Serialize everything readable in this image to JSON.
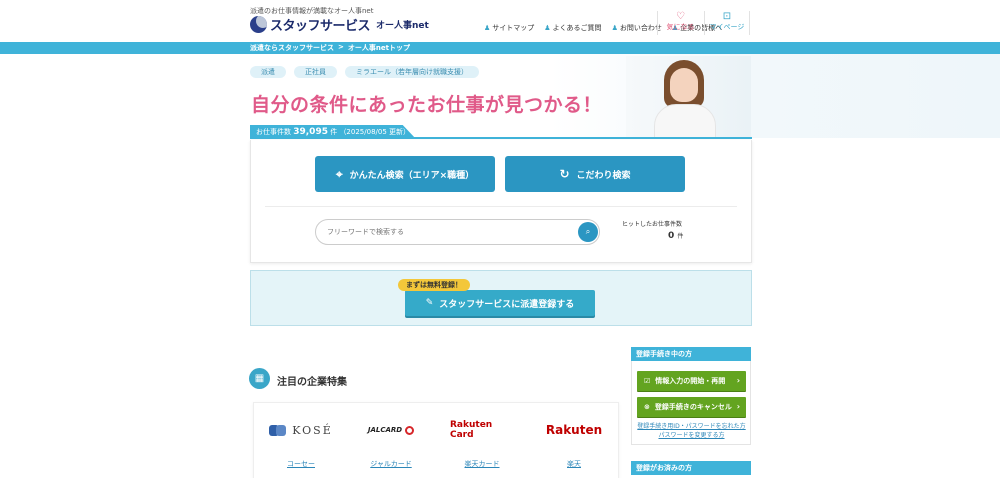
{
  "header": {
    "tagline": "派遣のお仕事情報が満載なオー人事net",
    "logo_text": "スタッフサービス",
    "logo_sub": "オー人事net",
    "nav": [
      {
        "label": "サイトマップ"
      },
      {
        "label": "よくあるご質問"
      },
      {
        "label": "お問い合わせ"
      },
      {
        "label": "企業の皆様へ"
      }
    ],
    "favorites_label": "気になる",
    "mypage_label": "マイページ"
  },
  "breadcrumb": {
    "items": [
      "派遣ならスタッフサービス",
      "オー人事netトップ"
    ],
    "separator": ">"
  },
  "hero": {
    "chips": [
      "派遣",
      "正社員",
      "ミラエール（若年層向け就職支援）"
    ],
    "title": "自分の条件にあったお仕事が見つかる！",
    "count_prefix": "お仕事件数",
    "count_value": "39,095",
    "count_unit": "件",
    "count_date": "（2025/08/05 更新）"
  },
  "search": {
    "easy_label": "かんたん検索（エリア×職種）",
    "kodawari_label": "こだわり検索",
    "free_placeholder": "フリーワードで検索する",
    "hit_label": "ヒットしたお仕事件数",
    "hit_value": "0",
    "hit_unit": "件"
  },
  "register": {
    "badge": "まずは無料登録！",
    "button": "スタッフサービスに派遣登録する"
  },
  "featured": {
    "title": "注目の企業特集",
    "companies": [
      {
        "logo": "KOSÉ",
        "link": "コーセー"
      },
      {
        "logo": "JALCARD",
        "link": "ジャルカード"
      },
      {
        "logo": "Rakuten Card",
        "link": "楽天カード"
      },
      {
        "logo": "Rakuten",
        "link": "楽天"
      }
    ]
  },
  "sidebar": {
    "in_progress_title": "登録手続き中の方",
    "start_button": "情報入力の開始・再開",
    "cancel_button": "登録手続きのキャンセル",
    "forgot_link": "登録手続き用ID・パスワードを忘れた方",
    "forgot_link2": "パスワードを変更する方",
    "registered_title": "登録がお済みの方"
  },
  "icons": {
    "fav": "heart-icon",
    "mypage": "mypage-icon",
    "search": "search-icon",
    "pencil": "pencil-icon",
    "building": "building-icon"
  },
  "colors": {
    "accent": "#3fb3d9",
    "button_blue": "#2b96c2",
    "title_pink": "#e05a89",
    "green": "#63a420"
  }
}
